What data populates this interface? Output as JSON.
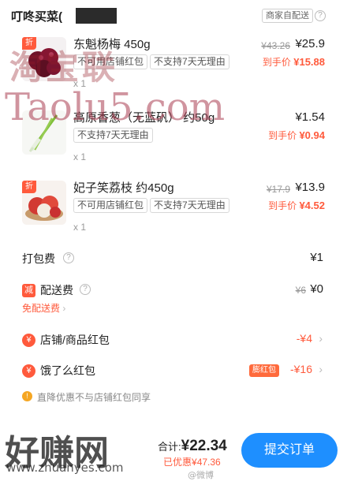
{
  "store": {
    "name": "叮咚买菜(",
    "merchant_badge": "商家自配送",
    "info_glyph": "?"
  },
  "products": [
    {
      "discount_tag": "折",
      "name": "东魁杨梅 450g",
      "tags": [
        "不可用店铺红包",
        "不支持7天无理由"
      ],
      "qty": "x 1",
      "original_price": "¥43.26",
      "price": "¥25.9",
      "final_label": "到手价",
      "final_price": "¥15.88",
      "image": "bayberry"
    },
    {
      "name": "高原香葱（无蓝矾） 约50g",
      "tags": [
        "不支持7天无理由"
      ],
      "qty": "x 1",
      "price": "¥1.54",
      "final_label": "到手价",
      "final_price": "¥0.94",
      "image": "scallion"
    },
    {
      "discount_tag": "折",
      "name": "妃子笑荔枝 约450g",
      "tags": [
        "不可用店铺红包",
        "不支持7天无理由"
      ],
      "qty": "x 1",
      "original_price": "¥17.9",
      "price": "¥13.9",
      "final_label": "到手价",
      "final_price": "¥4.52",
      "image": "lychee"
    }
  ],
  "fees": {
    "packing": {
      "label": "打包费",
      "value": "¥1"
    },
    "delivery": {
      "badge": "减",
      "label": "配送费",
      "original": "¥6",
      "value": "¥0",
      "free_link": "免配送费"
    },
    "store_coupon": {
      "icon": "¥",
      "label": "店铺/商品红包",
      "value": "-¥4"
    },
    "ele_coupon": {
      "icon": "¥",
      "label": "饿了么红包",
      "badge": "膨红包",
      "value": "-¥16"
    },
    "notice": {
      "icon": "!",
      "text": "直降优惠不与店铺红包同享"
    }
  },
  "footer": {
    "total_label": "合计:",
    "total": "¥22.34",
    "saved_label": "已优惠",
    "saved": "¥47.36",
    "submit": "提交订单"
  },
  "watermarks": {
    "top_cn": "淘宝联",
    "mid_en": "Taolu5.com",
    "bottom_cn": "好赚网",
    "bottom_url": "www.zhuanyes.com",
    "weibo": "@微博"
  },
  "colors": {
    "accent": "#ff5a3c",
    "submit_bg": "#1e8fff"
  }
}
